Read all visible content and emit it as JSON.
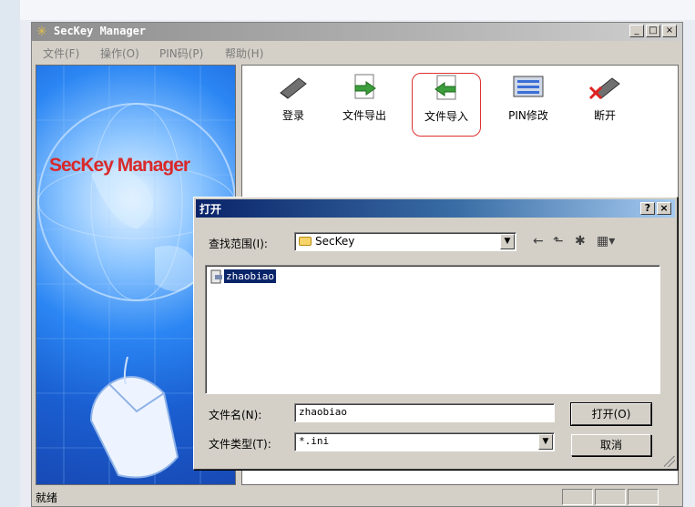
{
  "window": {
    "title": "SecKey Manager",
    "controls": [
      "_",
      "□",
      "×"
    ]
  },
  "menu": [
    {
      "label": "文件(F)"
    },
    {
      "label": "操作(O)"
    },
    {
      "label": "PIN码(P)"
    },
    {
      "label": "帮助(H)"
    }
  ],
  "splash": {
    "logo_text": "SecKey Manager"
  },
  "toolbar": [
    {
      "label": "登录",
      "icon": "usb-key-icon"
    },
    {
      "label": "文件导出",
      "icon": "file-export-icon"
    },
    {
      "label": "文件导入",
      "icon": "file-import-icon",
      "highlighted": true
    },
    {
      "label": "PIN修改",
      "icon": "pin-keyboard-icon"
    },
    {
      "label": "断开",
      "icon": "usb-key-disconnect-icon"
    }
  ],
  "dialog": {
    "title": "打开",
    "help_button": "?",
    "close_button": "×",
    "lookin_label": "查找范围(I):",
    "lookin_value": "SecKey",
    "files": [
      {
        "name": "zhaobiao",
        "selected": true
      }
    ],
    "filename_label": "文件名(N):",
    "filename_value": "zhaobiao",
    "filetype_label": "文件类型(T):",
    "filetype_value": "*.ini",
    "open_button": "打开(O)",
    "cancel_button": "取消"
  },
  "status": {
    "text": "就绪"
  },
  "colors": {
    "dialog_title_start": "#0a246a",
    "dialog_title_end": "#a6caf0",
    "highlight_ring": "#e03030",
    "selection": "#0a246a"
  }
}
